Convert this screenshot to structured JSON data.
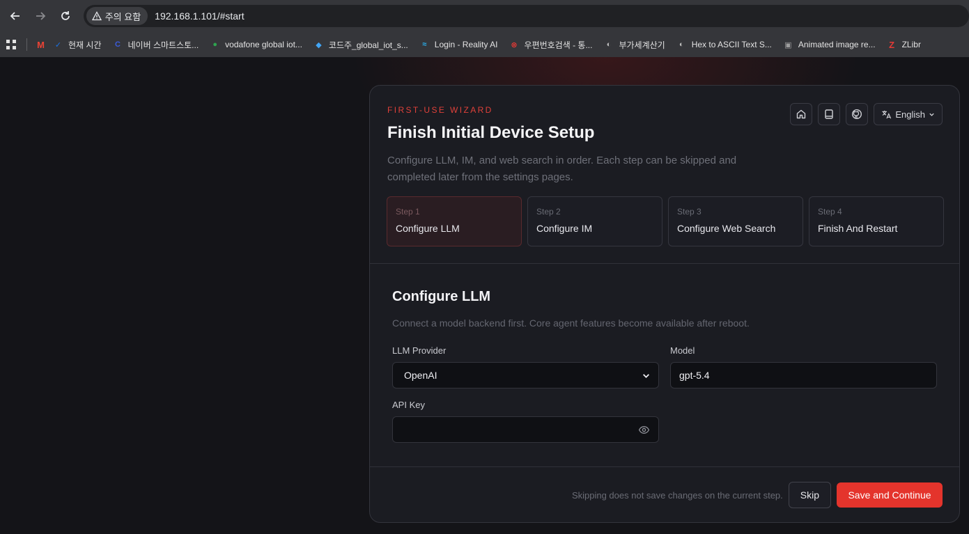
{
  "browser": {
    "security_chip": "주의 요함",
    "url": "192.168.1.101/#start",
    "bookmarks": [
      {
        "label": "",
        "icon": "gmail-icon",
        "color": "#ea4335"
      },
      {
        "label": "현재 시간",
        "icon": "clock-check-icon",
        "color": "#1a73e8"
      },
      {
        "label": "네이버 스마트스토...",
        "icon": "naver-icon",
        "color": "#3b5bdb"
      },
      {
        "label": "vodafone global iot...",
        "icon": "leaf-icon",
        "color": "#2ea44f"
      },
      {
        "label": "코드주_global_iot_s...",
        "icon": "flutter-icon",
        "color": "#42a5f5"
      },
      {
        "label": "Login - Reality AI",
        "icon": "wave-icon",
        "color": "#29b6f6"
      },
      {
        "label": "우편번호검색 - 통...",
        "icon": "post-icon",
        "color": "#e53935"
      },
      {
        "label": "부가세계산기",
        "icon": "globe-icon",
        "color": "#bdbdbd"
      },
      {
        "label": "Hex to ASCII Text S...",
        "icon": "globe-icon",
        "color": "#bdbdbd"
      },
      {
        "label": "Animated image re...",
        "icon": "image-icon",
        "color": "#9e9e9e"
      },
      {
        "label": "ZLibr",
        "icon": "z-icon",
        "color": "#e53935"
      }
    ]
  },
  "wizard": {
    "eyebrow": "FIRST-USE WIZARD",
    "title": "Finish Initial Device Setup",
    "subtitle": "Configure LLM, IM, and web search in order. Each step can be skipped and completed later from the settings pages.",
    "language": "English",
    "steps": [
      {
        "num": "Step 1",
        "label": "Configure LLM",
        "active": true
      },
      {
        "num": "Step 2",
        "label": "Configure IM",
        "active": false
      },
      {
        "num": "Step 3",
        "label": "Configure Web Search",
        "active": false
      },
      {
        "num": "Step 4",
        "label": "Finish And Restart",
        "active": false
      }
    ],
    "section": {
      "title": "Configure LLM",
      "description": "Connect a model backend first. Core agent features become available after reboot.",
      "provider_label": "LLM Provider",
      "provider_value": "OpenAI",
      "model_label": "Model",
      "model_value": "gpt-5.4",
      "api_key_label": "API Key",
      "api_key_value": ""
    },
    "footer": {
      "note": "Skipping does not save changes on the current step.",
      "skip": "Skip",
      "save": "Save and Continue"
    }
  },
  "colors": {
    "accent": "#e4342c",
    "eyebrow": "#e0413a"
  }
}
